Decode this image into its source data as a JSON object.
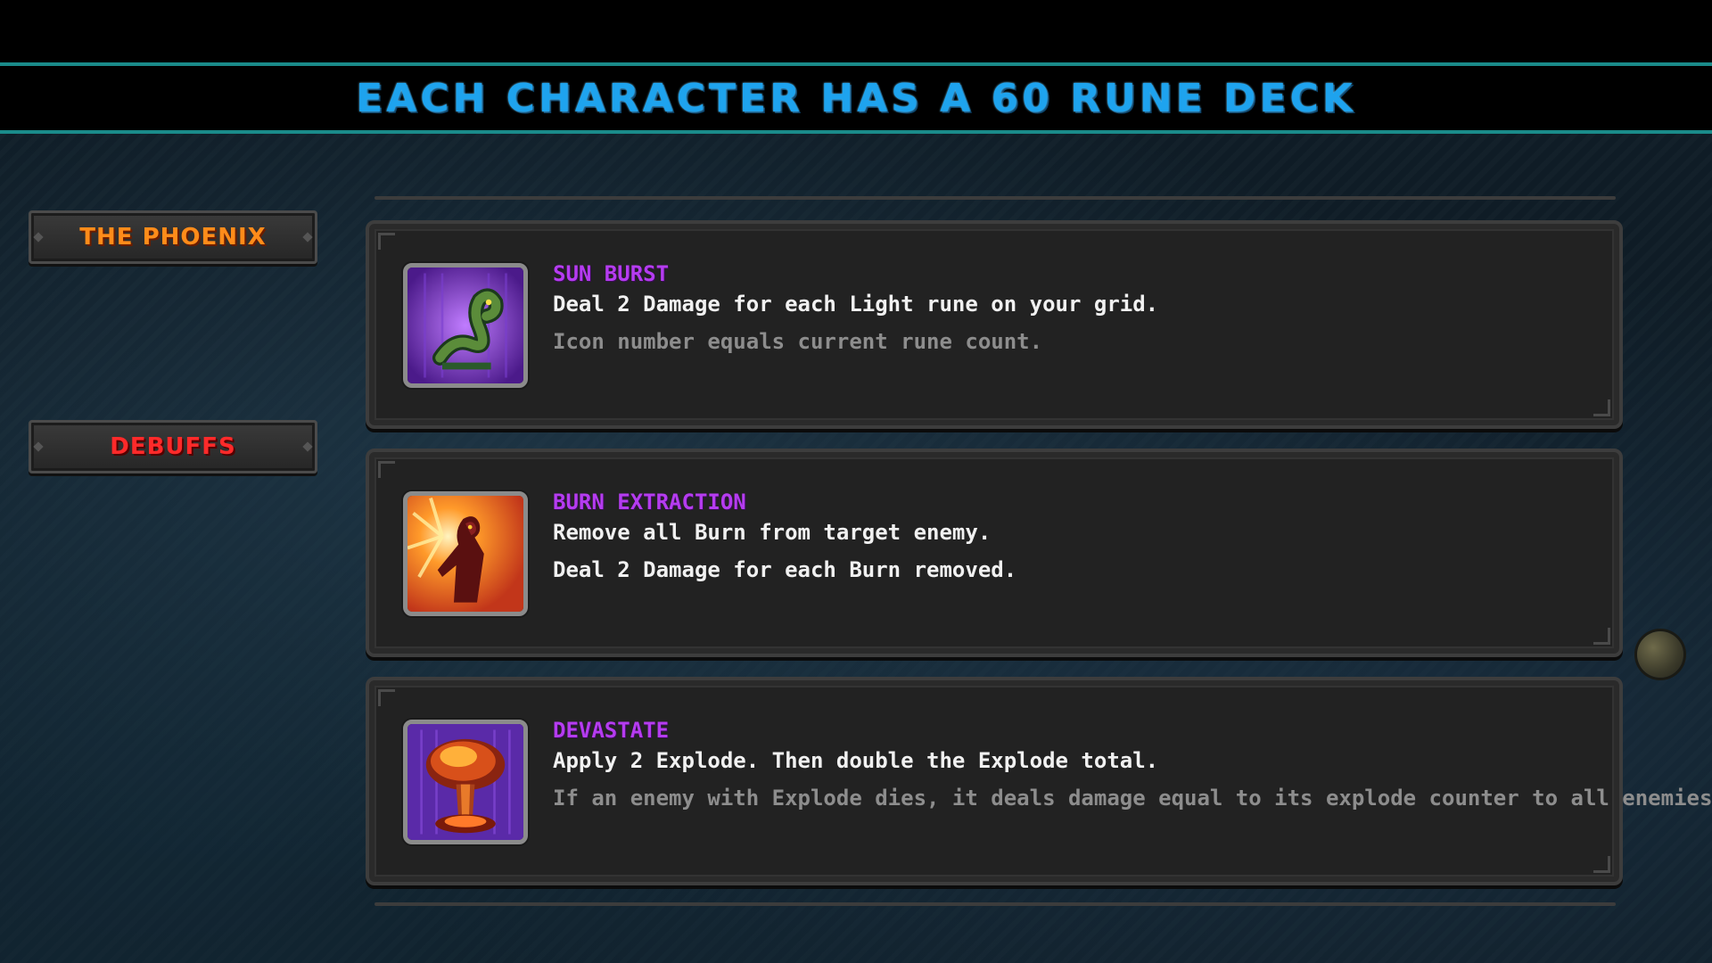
{
  "banner": {
    "title": "EACH CHARACTER HAS A 60 RUNE DECK"
  },
  "sidebar": {
    "items": [
      {
        "label": "THE PHOENIX",
        "color": "#ff8c1a"
      },
      {
        "label": "DEBUFFS",
        "color": "#ff2a2a"
      }
    ]
  },
  "runes": [
    {
      "name": "SUN BURST",
      "line1": "Deal 2 Damage for each Light rune on your grid.",
      "line2": "Icon number equals current rune count.",
      "line2_style": "muted",
      "icon": "serpent-icon"
    },
    {
      "name": "BURN EXTRACTION",
      "line1": "Remove all Burn from target enemy.",
      "line2": "Deal 2 Damage for each Burn removed.",
      "line2_style": "bright",
      "icon": "burning-figure-icon"
    },
    {
      "name": "DEVASTATE",
      "line1": "Apply 2 Explode. Then double the Explode total.",
      "line2": "If an enemy with Explode dies, it deals damage equal to its explode counter to all enemies.",
      "line2_style": "muted",
      "icon": "mushroom-cloud-icon"
    }
  ],
  "colors": {
    "title": "#1ea3ee",
    "accent_line": "#1a8b8a",
    "rune_name": "#b53cf0"
  }
}
